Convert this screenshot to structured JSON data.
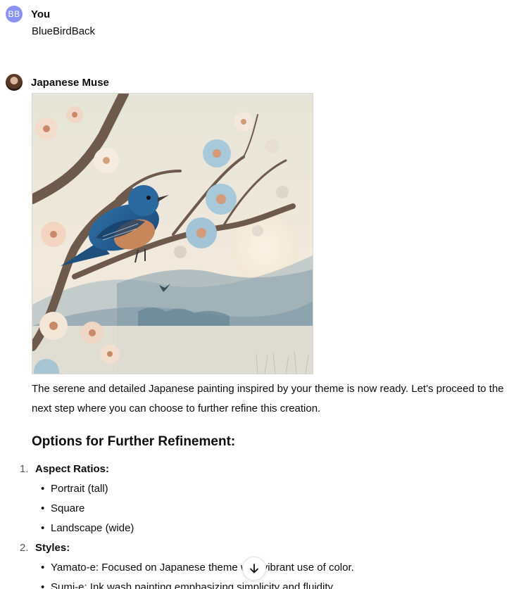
{
  "user_message": {
    "avatar_initials": "BB",
    "author": "You",
    "text": "BlueBirdBack"
  },
  "assistant_message": {
    "author": "Japanese Muse",
    "image": {
      "subject": "bluebird on cherry blossom branch with misty hills"
    },
    "paragraph": "The serene and detailed Japanese painting inspired by your theme is now ready. Let's proceed to the next step where you can choose to further refine this creation.",
    "section_title": "Options for Further Refinement:",
    "options": [
      {
        "number": "1.",
        "label": "Aspect Ratios:",
        "items": [
          "Portrait (tall)",
          "Square",
          "Landscape (wide)"
        ]
      },
      {
        "number": "2.",
        "label": "Styles:",
        "items": [
          "Yamato-e: Focused on Japanese theme with vibrant use of color.",
          "Sumi-e: Ink wash painting emphasizing simplicity and fluidity."
        ]
      }
    ]
  },
  "icons": {
    "scroll_down": "arrow-down-icon",
    "bullet": "•"
  },
  "colors": {
    "user_avatar": "#8b93f2",
    "text": "#0d0d0d"
  }
}
